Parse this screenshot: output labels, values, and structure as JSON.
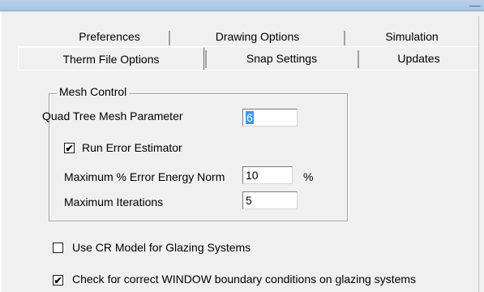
{
  "tabs": {
    "back_row": [
      "Preferences",
      "Drawing Options",
      "Simulation"
    ],
    "front_row": [
      "Therm File Options",
      "Snap Settings",
      "Updates"
    ],
    "selected": "Therm File Options"
  },
  "mesh_control": {
    "title": "Mesh Control",
    "quad_tree_label": "Quad Tree Mesh Parameter",
    "quad_tree_value": "6",
    "run_error_label": "Run Error Estimator",
    "run_error_checked": true,
    "check_mark": "✔",
    "max_error_label": "Maximum % Error Energy Norm",
    "max_error_value": "10",
    "max_error_unit": "%",
    "max_iter_label": "Maximum Iterations",
    "max_iter_value": "5"
  },
  "options": {
    "cr_model_label": "Use CR Model for Glazing Systems",
    "cr_model_checked": false,
    "window_bc_label": "Check for correct WINDOW boundary conditions on glazing systems",
    "window_bc_checked": true
  },
  "colors": {
    "selection": "#3399ff",
    "titlebar": "#b9d1ea",
    "dialog_bg": "#f0f0f0"
  }
}
